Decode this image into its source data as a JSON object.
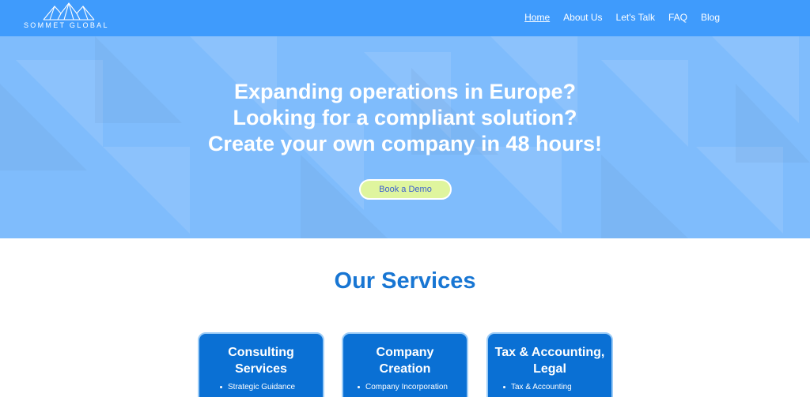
{
  "brand": {
    "name": "SOMMET GLOBAL",
    "logo_icon": "mountains-icon"
  },
  "nav": {
    "items": [
      {
        "label": "Home",
        "active": true
      },
      {
        "label": "About Us",
        "active": false
      },
      {
        "label": "Let's Talk",
        "active": false
      },
      {
        "label": "FAQ",
        "active": false
      },
      {
        "label": "Blog",
        "active": false
      }
    ]
  },
  "hero": {
    "lines": [
      "Expanding operations in Europe?",
      "Looking for a compliant solution?",
      "Create your own company in 48 hours!"
    ],
    "cta_label": "Book a Demo"
  },
  "services": {
    "title": "Our Services",
    "cards": [
      {
        "title_lines": [
          "Consulting",
          "Services"
        ],
        "items": [
          "Strategic Guidance"
        ]
      },
      {
        "title_lines": [
          "Company",
          "Creation"
        ],
        "items": [
          "Company Incorporation"
        ]
      },
      {
        "title_lines": [
          "Tax & Accounting,",
          "Legal"
        ],
        "items": [
          "Tax & Accounting"
        ]
      }
    ]
  },
  "colors": {
    "header_bg": "#3f9bfc",
    "hero_bg": "#7fbcfc",
    "cta_bg": "#dff59e",
    "accent": "#1876d3",
    "card_bg": "#0a70d4"
  }
}
